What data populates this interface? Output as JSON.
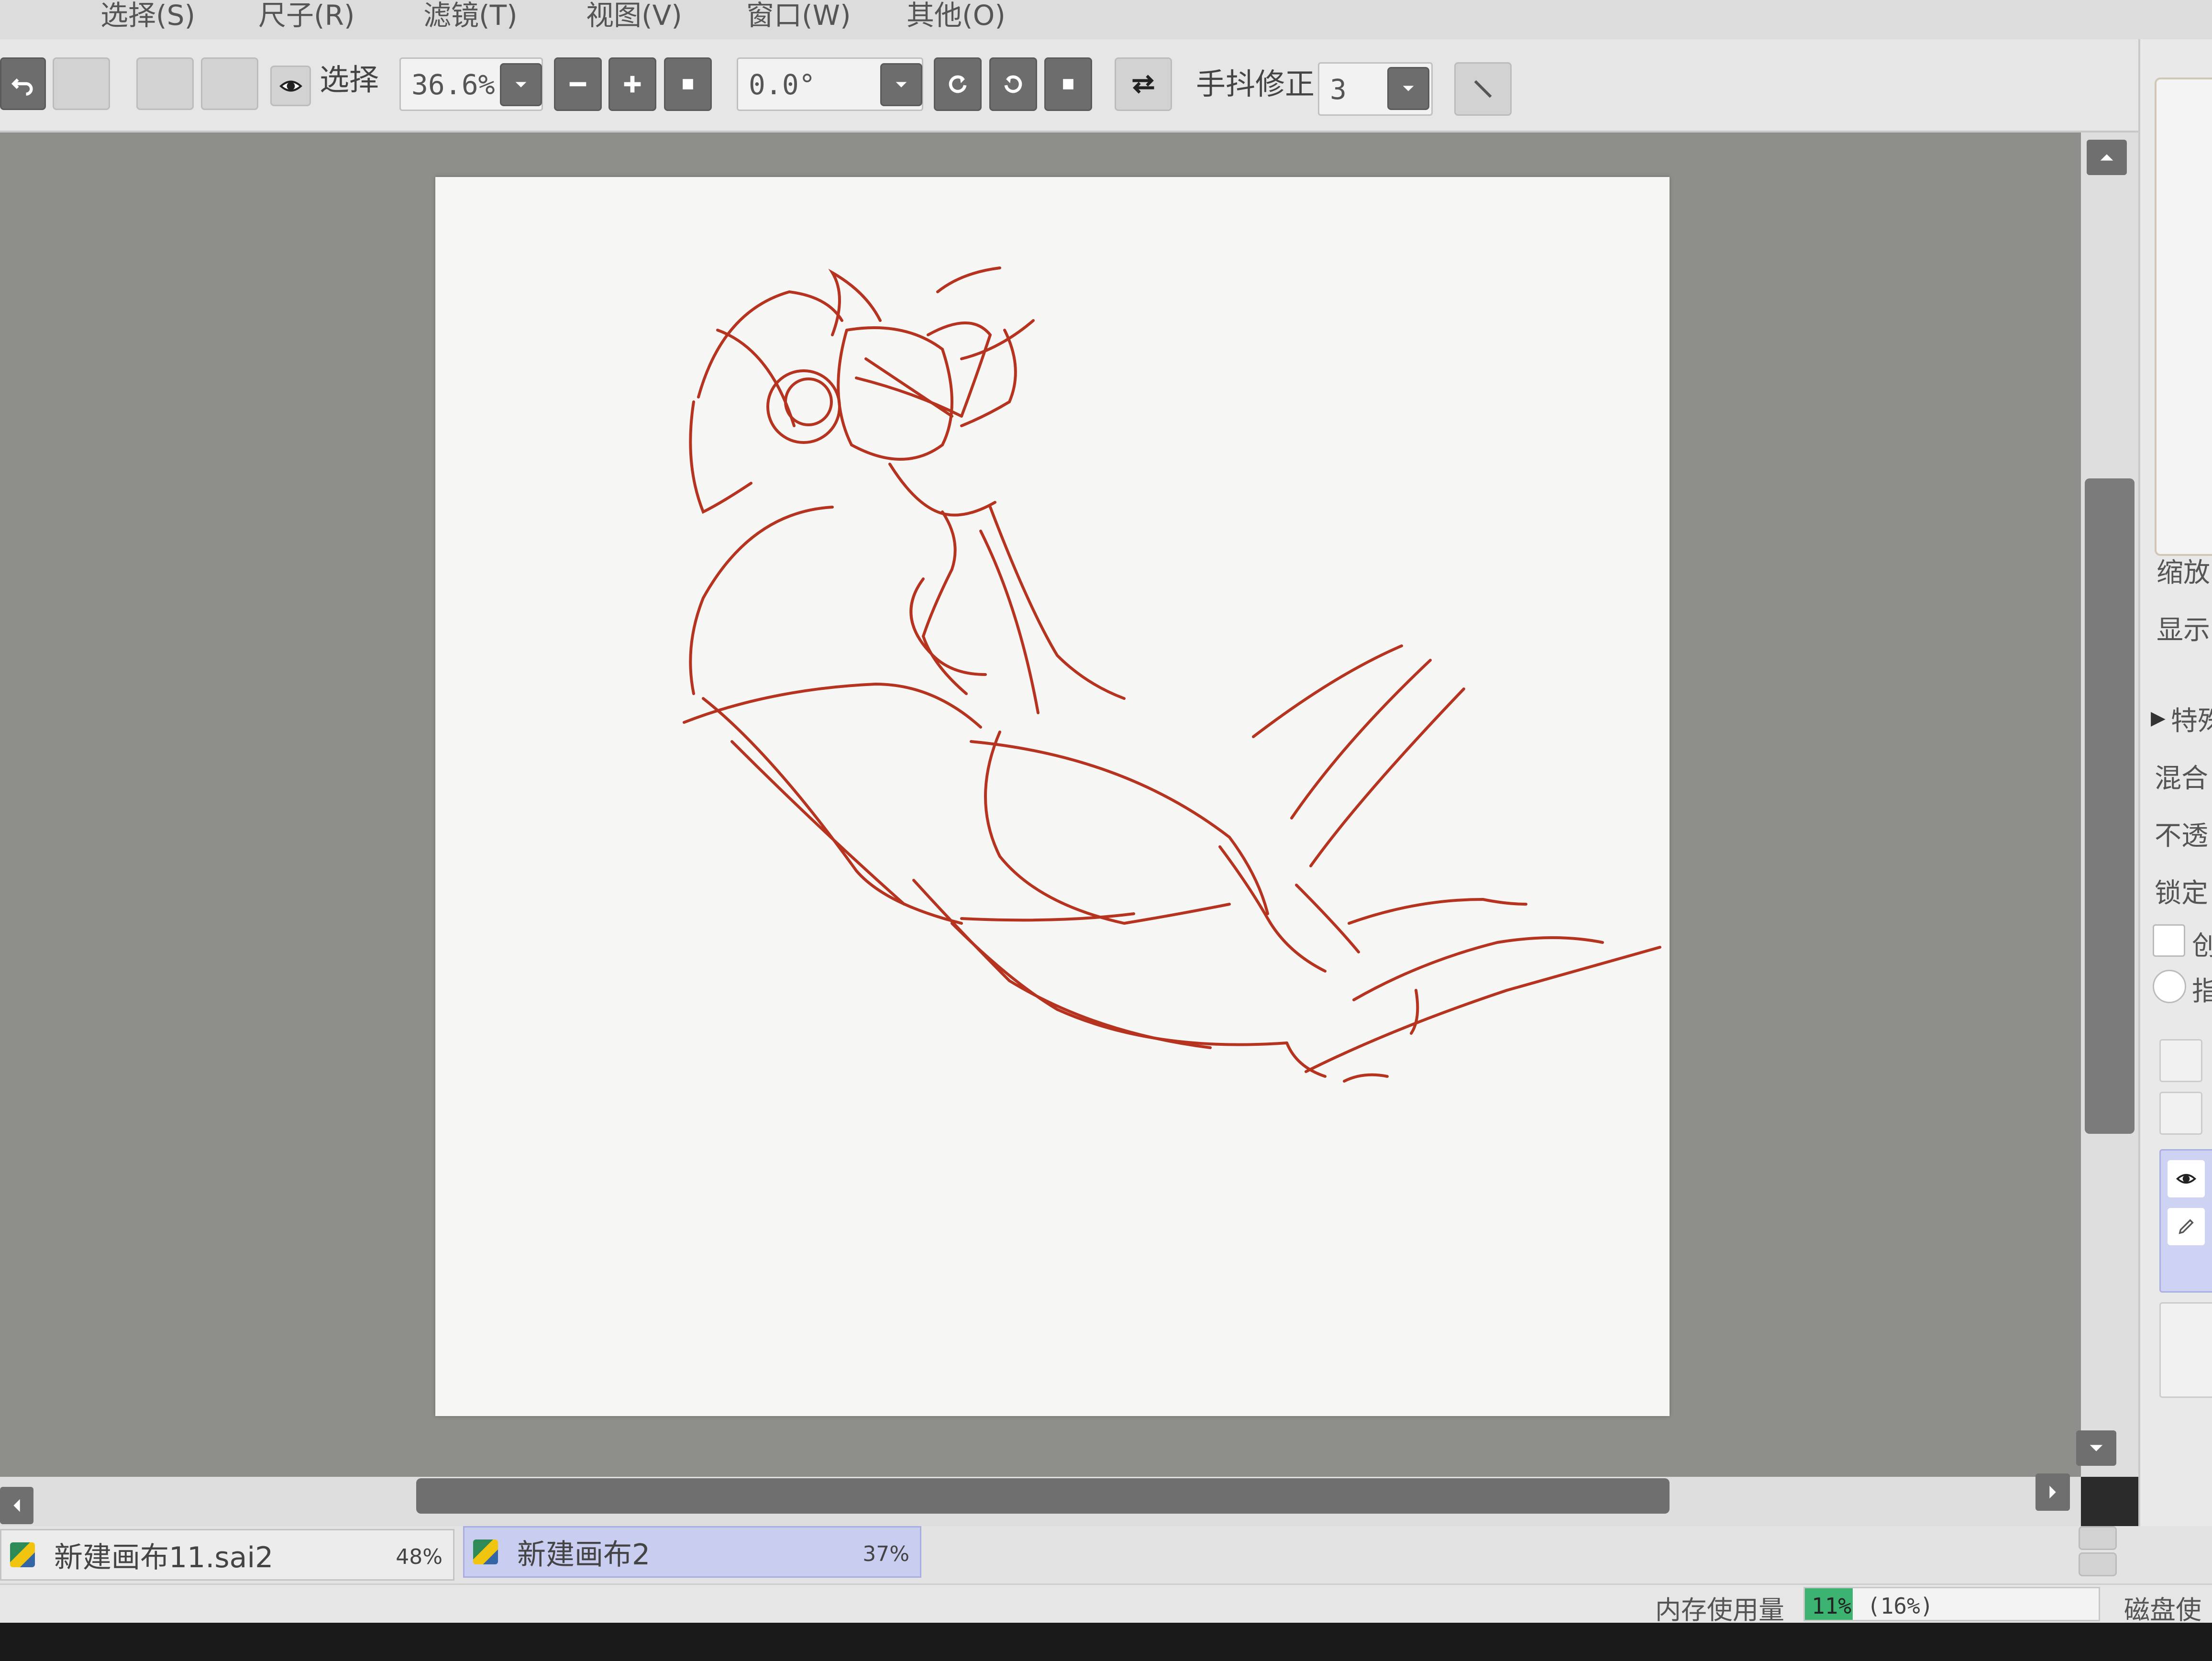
{
  "menu": {
    "items": [
      "选择(S)",
      "尺子(R)",
      "滤镜(T)",
      "视图(V)",
      "窗口(W)",
      "其他(O)"
    ]
  },
  "toolbar": {
    "selection_label": "选择",
    "zoom_value": "36.6%",
    "rotation_value": "0.0°",
    "stabilizer_label": "手抖修正",
    "stabilizer_value": "3"
  },
  "right_panel": {
    "labels": [
      "缩放",
      "显示",
      "特殊",
      "混合",
      "不透",
      "锁定",
      "创",
      "指"
    ]
  },
  "tabs": [
    {
      "name": "新建画布11.sai2",
      "zoom": "48%",
      "active": false
    },
    {
      "name": "新建画布2",
      "zoom": "37%",
      "active": true
    }
  ],
  "status": {
    "memory_label": "内存使用量",
    "memory_value": "11%",
    "memory_peak": "(16%)",
    "disk_label": "磁盘使"
  },
  "colors": {
    "canvas_bg": "#8e8f8a",
    "paper": "#f6f6f4",
    "sketch_stroke": "#b5331f",
    "active_tab": "#c9cdf0",
    "memory_bar": "#3cb371"
  },
  "icons": [
    "undo-icon",
    "redo-icon",
    "eye-icon",
    "zoom-out-icon",
    "zoom-in-icon",
    "reset-zoom-icon",
    "rotate-left-icon",
    "rotate-right-icon",
    "reset-rotate-icon",
    "flip-horizontal-icon",
    "pen-icon",
    "scroll-up-icon",
    "scroll-down-icon",
    "scroll-left-icon",
    "scroll-right-icon",
    "canvas-file-icon"
  ]
}
